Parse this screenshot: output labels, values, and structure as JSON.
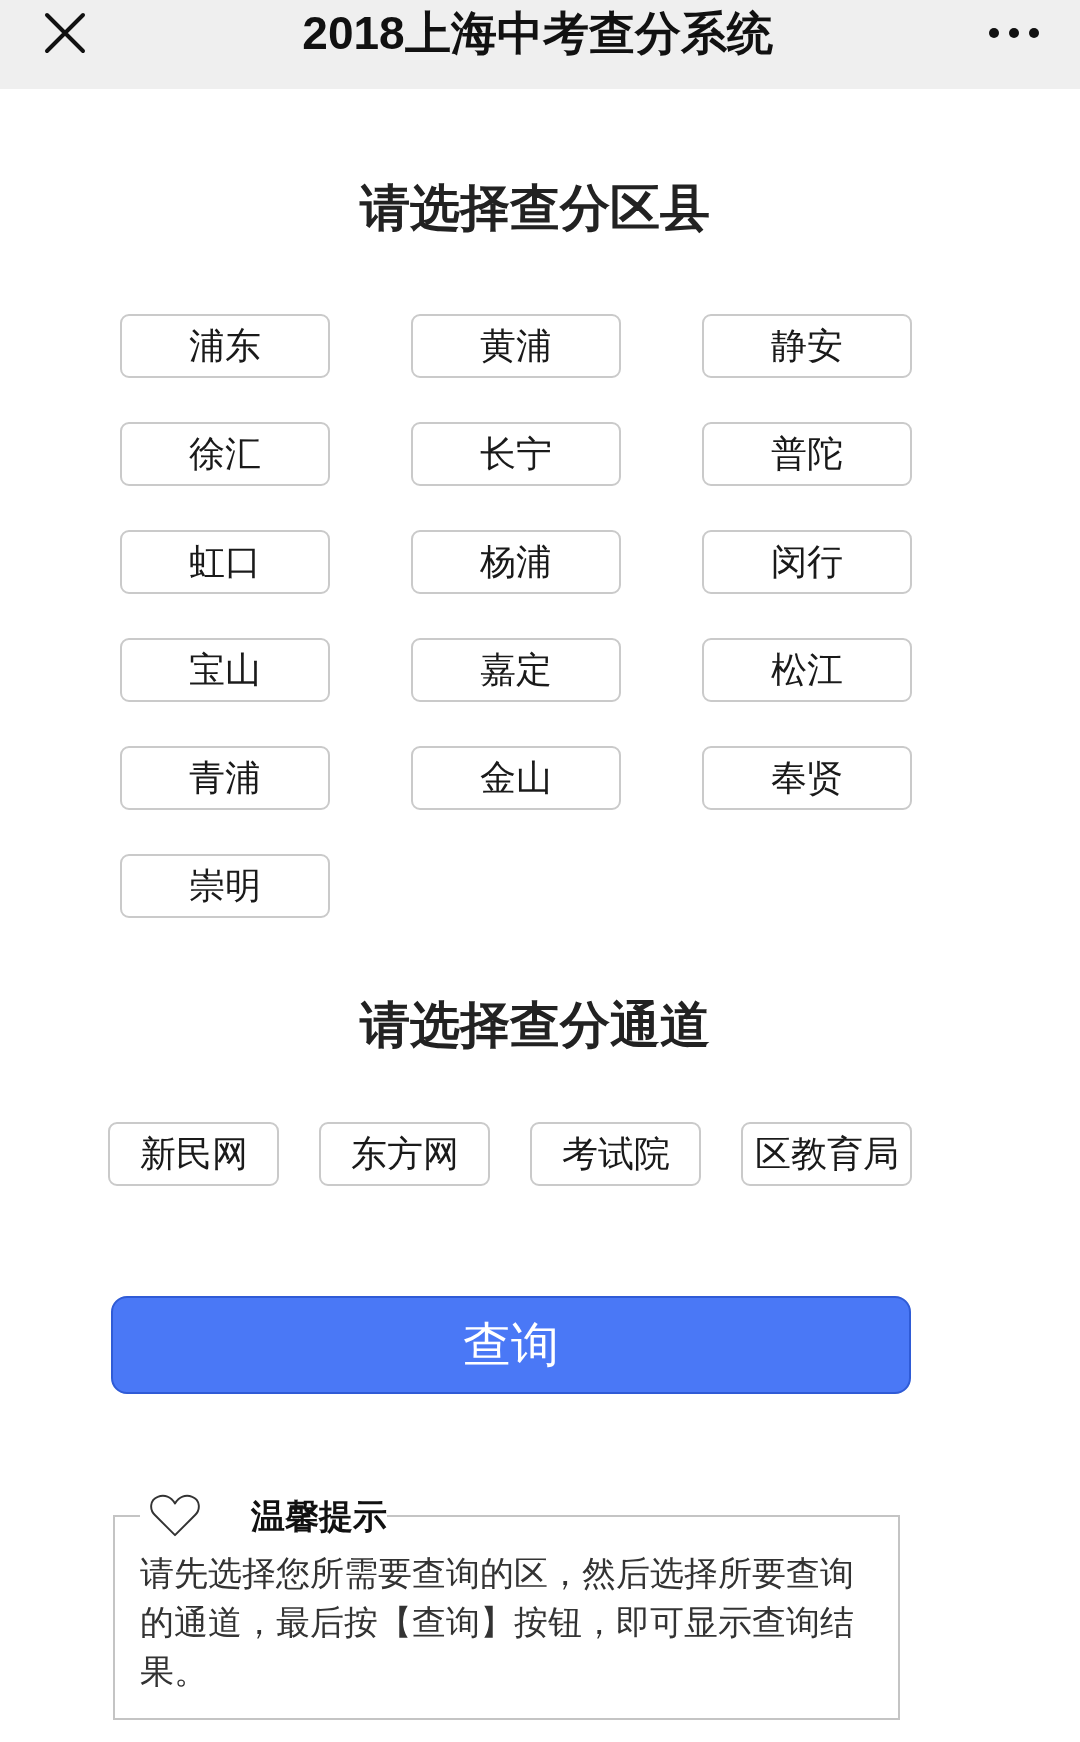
{
  "window": {
    "title": "2018上海中考查分系统"
  },
  "district_section": {
    "heading": "请选择查分区县",
    "districts": [
      {
        "label": "浦东",
        "selected": false
      },
      {
        "label": "黄浦",
        "selected": false
      },
      {
        "label": "静安",
        "selected": false
      },
      {
        "label": "徐汇",
        "selected": false
      },
      {
        "label": "长宁",
        "selected": false
      },
      {
        "label": "普陀",
        "selected": false
      },
      {
        "label": "虹口",
        "selected": false
      },
      {
        "label": "杨浦",
        "selected": false
      },
      {
        "label": "闵行",
        "selected": false
      },
      {
        "label": "宝山",
        "selected": false
      },
      {
        "label": "嘉定",
        "selected": false
      },
      {
        "label": "松江",
        "selected": false
      },
      {
        "label": "青浦",
        "selected": false
      },
      {
        "label": "金山",
        "selected": false
      },
      {
        "label": "奉贤",
        "selected": false
      },
      {
        "label": "崇明",
        "selected": false
      }
    ]
  },
  "channel_section": {
    "heading": "请选择查分通道",
    "channels": [
      {
        "label": "新民网",
        "selected": false
      },
      {
        "label": "东方网",
        "selected": false
      },
      {
        "label": "考试院",
        "selected": false
      },
      {
        "label": "区教育局",
        "selected": false
      }
    ]
  },
  "query_button": {
    "label": "查询"
  },
  "tips": {
    "title": "温馨提示",
    "text": "请先选择您所需要查询的区，然后选择所要查询的通道，最后按【查询】按钮，即可显示查询结果。"
  }
}
